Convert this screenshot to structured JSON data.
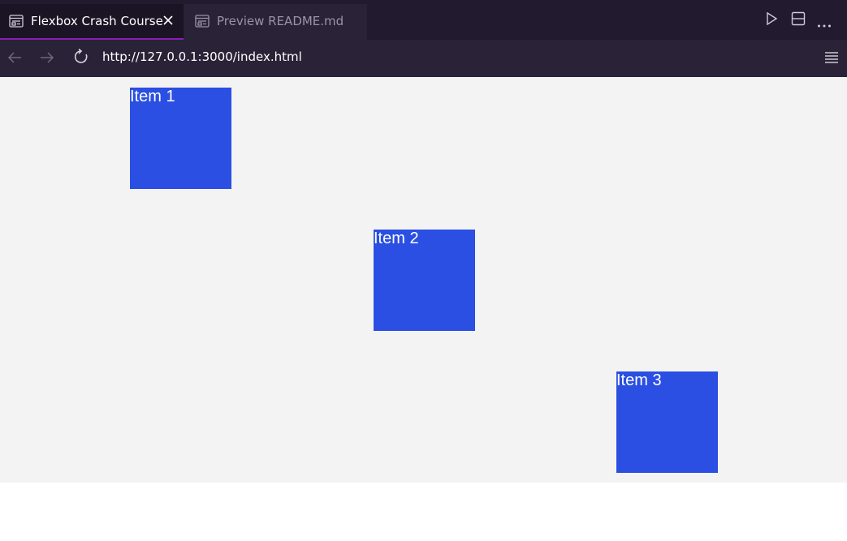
{
  "tabs": [
    {
      "label": "Flexbox Crash Course",
      "icon": "preview-icon",
      "active": true
    },
    {
      "label": "Preview README.md",
      "icon": "preview-icon",
      "active": false
    }
  ],
  "toolbar_icons": [
    "run-icon",
    "split-editor-icon",
    "more-icon"
  ],
  "nav": {
    "url": "http://127.0.0.1:3000/index.html",
    "icons": [
      "back-arrow-icon",
      "forward-arrow-icon",
      "reload-icon",
      "menu-icon"
    ]
  },
  "page": {
    "items": [
      {
        "label": "Item 1"
      },
      {
        "label": "Item 2"
      },
      {
        "label": "Item 3"
      }
    ]
  },
  "colors": {
    "accent": "#8a1fb5",
    "item_bg": "#2a4fe2",
    "page_bg": "#f3f3f3",
    "tabbar_bg": "#221a2e"
  }
}
